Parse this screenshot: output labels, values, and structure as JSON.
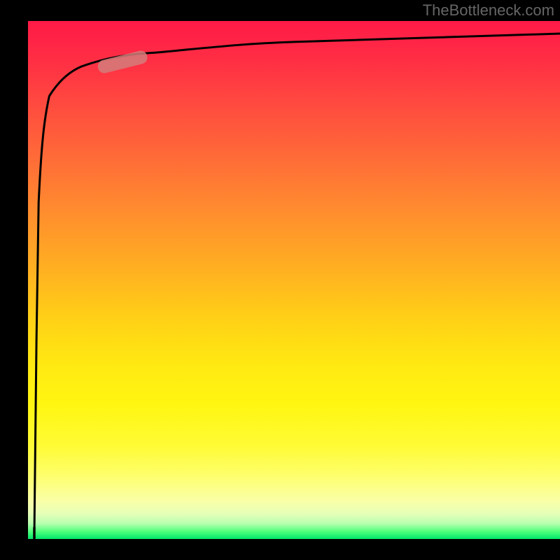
{
  "attribution": "TheBottleneck.com",
  "chart_data": {
    "type": "line",
    "title": "",
    "xlabel": "",
    "ylabel": "",
    "xlim": [
      0,
      100
    ],
    "ylim": [
      0,
      100
    ],
    "grid": false,
    "legend": false,
    "background_gradient_stops": [
      {
        "pos": 0.0,
        "color": "#ff1a47"
      },
      {
        "pos": 0.26,
        "color": "#ff6a38"
      },
      {
        "pos": 0.58,
        "color": "#ffd216"
      },
      {
        "pos": 0.88,
        "color": "#feff6f"
      },
      {
        "pos": 1.0,
        "color": "#00e56a"
      }
    ],
    "series": [
      {
        "name": "curve",
        "x": [
          1.2,
          1.4,
          1.6,
          2.0,
          2.5,
          3.0,
          4.0,
          5.5,
          7.5,
          10,
          14,
          18,
          24,
          32,
          45,
          60,
          78,
          100
        ],
        "y": [
          2,
          20,
          45,
          65,
          76,
          81,
          85.5,
          88,
          89.7,
          91,
          92.2,
          93.1,
          93.9,
          94.6,
          95.3,
          95.9,
          96.4,
          97
        ]
      },
      {
        "name": "vertical-drop",
        "x": [
          1.2,
          1.2
        ],
        "y": [
          2,
          100
        ]
      }
    ],
    "highlight_segment": {
      "on_series": "curve",
      "x_range": [
        13,
        22
      ],
      "color": "#d37d7a"
    }
  }
}
